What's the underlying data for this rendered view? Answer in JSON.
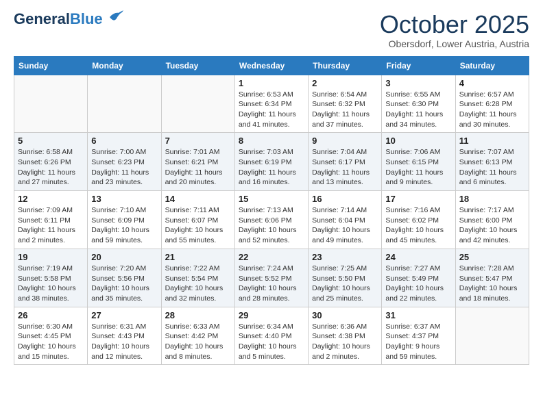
{
  "header": {
    "logo_general": "General",
    "logo_blue": "Blue",
    "month": "October 2025",
    "location": "Obersdorf, Lower Austria, Austria"
  },
  "days_of_week": [
    "Sunday",
    "Monday",
    "Tuesday",
    "Wednesday",
    "Thursday",
    "Friday",
    "Saturday"
  ],
  "weeks": [
    [
      {
        "day": "",
        "info": ""
      },
      {
        "day": "",
        "info": ""
      },
      {
        "day": "",
        "info": ""
      },
      {
        "day": "1",
        "info": "Sunrise: 6:53 AM\nSunset: 6:34 PM\nDaylight: 11 hours\nand 41 minutes."
      },
      {
        "day": "2",
        "info": "Sunrise: 6:54 AM\nSunset: 6:32 PM\nDaylight: 11 hours\nand 37 minutes."
      },
      {
        "day": "3",
        "info": "Sunrise: 6:55 AM\nSunset: 6:30 PM\nDaylight: 11 hours\nand 34 minutes."
      },
      {
        "day": "4",
        "info": "Sunrise: 6:57 AM\nSunset: 6:28 PM\nDaylight: 11 hours\nand 30 minutes."
      }
    ],
    [
      {
        "day": "5",
        "info": "Sunrise: 6:58 AM\nSunset: 6:26 PM\nDaylight: 11 hours\nand 27 minutes."
      },
      {
        "day": "6",
        "info": "Sunrise: 7:00 AM\nSunset: 6:23 PM\nDaylight: 11 hours\nand 23 minutes."
      },
      {
        "day": "7",
        "info": "Sunrise: 7:01 AM\nSunset: 6:21 PM\nDaylight: 11 hours\nand 20 minutes."
      },
      {
        "day": "8",
        "info": "Sunrise: 7:03 AM\nSunset: 6:19 PM\nDaylight: 11 hours\nand 16 minutes."
      },
      {
        "day": "9",
        "info": "Sunrise: 7:04 AM\nSunset: 6:17 PM\nDaylight: 11 hours\nand 13 minutes."
      },
      {
        "day": "10",
        "info": "Sunrise: 7:06 AM\nSunset: 6:15 PM\nDaylight: 11 hours\nand 9 minutes."
      },
      {
        "day": "11",
        "info": "Sunrise: 7:07 AM\nSunset: 6:13 PM\nDaylight: 11 hours\nand 6 minutes."
      }
    ],
    [
      {
        "day": "12",
        "info": "Sunrise: 7:09 AM\nSunset: 6:11 PM\nDaylight: 11 hours\nand 2 minutes."
      },
      {
        "day": "13",
        "info": "Sunrise: 7:10 AM\nSunset: 6:09 PM\nDaylight: 10 hours\nand 59 minutes."
      },
      {
        "day": "14",
        "info": "Sunrise: 7:11 AM\nSunset: 6:07 PM\nDaylight: 10 hours\nand 55 minutes."
      },
      {
        "day": "15",
        "info": "Sunrise: 7:13 AM\nSunset: 6:06 PM\nDaylight: 10 hours\nand 52 minutes."
      },
      {
        "day": "16",
        "info": "Sunrise: 7:14 AM\nSunset: 6:04 PM\nDaylight: 10 hours\nand 49 minutes."
      },
      {
        "day": "17",
        "info": "Sunrise: 7:16 AM\nSunset: 6:02 PM\nDaylight: 10 hours\nand 45 minutes."
      },
      {
        "day": "18",
        "info": "Sunrise: 7:17 AM\nSunset: 6:00 PM\nDaylight: 10 hours\nand 42 minutes."
      }
    ],
    [
      {
        "day": "19",
        "info": "Sunrise: 7:19 AM\nSunset: 5:58 PM\nDaylight: 10 hours\nand 38 minutes."
      },
      {
        "day": "20",
        "info": "Sunrise: 7:20 AM\nSunset: 5:56 PM\nDaylight: 10 hours\nand 35 minutes."
      },
      {
        "day": "21",
        "info": "Sunrise: 7:22 AM\nSunset: 5:54 PM\nDaylight: 10 hours\nand 32 minutes."
      },
      {
        "day": "22",
        "info": "Sunrise: 7:24 AM\nSunset: 5:52 PM\nDaylight: 10 hours\nand 28 minutes."
      },
      {
        "day": "23",
        "info": "Sunrise: 7:25 AM\nSunset: 5:50 PM\nDaylight: 10 hours\nand 25 minutes."
      },
      {
        "day": "24",
        "info": "Sunrise: 7:27 AM\nSunset: 5:49 PM\nDaylight: 10 hours\nand 22 minutes."
      },
      {
        "day": "25",
        "info": "Sunrise: 7:28 AM\nSunset: 5:47 PM\nDaylight: 10 hours\nand 18 minutes."
      }
    ],
    [
      {
        "day": "26",
        "info": "Sunrise: 6:30 AM\nSunset: 4:45 PM\nDaylight: 10 hours\nand 15 minutes."
      },
      {
        "day": "27",
        "info": "Sunrise: 6:31 AM\nSunset: 4:43 PM\nDaylight: 10 hours\nand 12 minutes."
      },
      {
        "day": "28",
        "info": "Sunrise: 6:33 AM\nSunset: 4:42 PM\nDaylight: 10 hours\nand 8 minutes."
      },
      {
        "day": "29",
        "info": "Sunrise: 6:34 AM\nSunset: 4:40 PM\nDaylight: 10 hours\nand 5 minutes."
      },
      {
        "day": "30",
        "info": "Sunrise: 6:36 AM\nSunset: 4:38 PM\nDaylight: 10 hours\nand 2 minutes."
      },
      {
        "day": "31",
        "info": "Sunrise: 6:37 AM\nSunset: 4:37 PM\nDaylight: 9 hours\nand 59 minutes."
      },
      {
        "day": "",
        "info": ""
      }
    ]
  ]
}
